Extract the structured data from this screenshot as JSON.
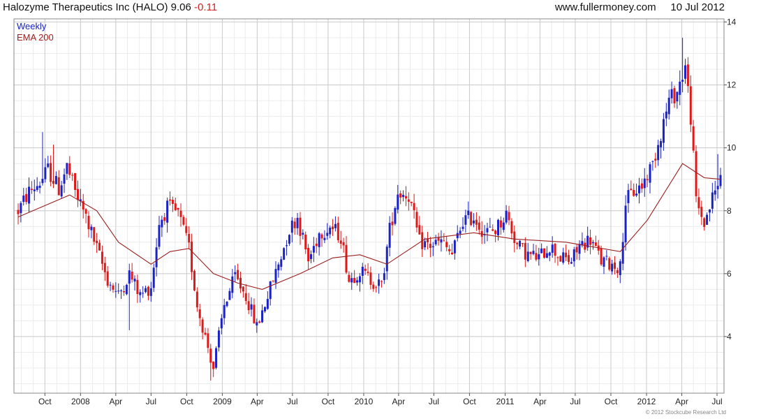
{
  "header": {
    "title": "Halozyme Therapeutics Inc (HALO)",
    "last": "9.06",
    "change": "-0.11",
    "source": "www.fullermoney.com",
    "date": "10 Jul 2012"
  },
  "legend": {
    "period": "Weekly",
    "ema": "EMA 200"
  },
  "copyright": "© 2012 Stockcube Research Ltd",
  "colors": {
    "up": "#1a22c8",
    "down": "#e01818",
    "ema": "#9a2020",
    "grid": "#cccccc",
    "header_change": "#d42020"
  },
  "chart_data": {
    "type": "candlestick",
    "period": "weekly",
    "ylim": [
      2.2,
      14.1
    ],
    "y_ticks": [
      4,
      6,
      8,
      10,
      12,
      14
    ],
    "y_axis_side": "right",
    "grid": true,
    "x_range": [
      "2007-07-24",
      "2012-07-10"
    ],
    "x_ticks": [
      {
        "date": "2007-10-01",
        "label": "Oct"
      },
      {
        "date": "2008-01-01",
        "label": "2008"
      },
      {
        "date": "2008-04-01",
        "label": "Apr"
      },
      {
        "date": "2008-07-01",
        "label": "Jul"
      },
      {
        "date": "2008-10-01",
        "label": "Oct"
      },
      {
        "date": "2009-01-01",
        "label": "2009"
      },
      {
        "date": "2009-04-01",
        "label": "Apr"
      },
      {
        "date": "2009-07-01",
        "label": "Jul"
      },
      {
        "date": "2009-10-01",
        "label": "Oct"
      },
      {
        "date": "2010-01-01",
        "label": "2010"
      },
      {
        "date": "2010-04-01",
        "label": "Apr"
      },
      {
        "date": "2010-07-01",
        "label": "Jul"
      },
      {
        "date": "2010-10-01",
        "label": "Oct"
      },
      {
        "date": "2011-01-01",
        "label": "2011"
      },
      {
        "date": "2011-04-01",
        "label": "Apr"
      },
      {
        "date": "2011-07-01",
        "label": "Jul"
      },
      {
        "date": "2011-10-01",
        "label": "Oct"
      },
      {
        "date": "2012-01-01",
        "label": "2012"
      },
      {
        "date": "2012-04-01",
        "label": "Apr"
      },
      {
        "date": "2012-07-01",
        "label": "Jul"
      }
    ],
    "price_path": [
      [
        "2007-07-24",
        8.0
      ],
      [
        "2007-08-21",
        8.6
      ],
      [
        "2007-09-18",
        8.9
      ],
      [
        "2007-10-09",
        9.3
      ],
      [
        "2007-11-06",
        8.7
      ],
      [
        "2007-11-27",
        9.4
      ],
      [
        "2007-12-18",
        8.6
      ],
      [
        "2008-01-15",
        7.8
      ],
      [
        "2008-02-12",
        6.8
      ],
      [
        "2008-03-11",
        5.8
      ],
      [
        "2008-04-08",
        5.3
      ],
      [
        "2008-05-06",
        6.0
      ],
      [
        "2008-06-03",
        5.3
      ],
      [
        "2008-07-01",
        5.6
      ],
      [
        "2008-07-22",
        7.6
      ],
      [
        "2008-08-12",
        8.1
      ],
      [
        "2008-09-09",
        7.9
      ],
      [
        "2008-10-07",
        6.8
      ],
      [
        "2008-10-28",
        5.0
      ],
      [
        "2008-11-18",
        4.0
      ],
      [
        "2008-12-09",
        3.0
      ],
      [
        "2009-01-06",
        5.0
      ],
      [
        "2009-02-03",
        5.9
      ],
      [
        "2009-03-03",
        5.3
      ],
      [
        "2009-03-31",
        4.3
      ],
      [
        "2009-04-28",
        5.3
      ],
      [
        "2009-05-26",
        6.3
      ],
      [
        "2009-06-23",
        7.4
      ],
      [
        "2009-07-14",
        7.8
      ],
      [
        "2009-08-11",
        6.4
      ],
      [
        "2009-09-08",
        7.3
      ],
      [
        "2009-10-06",
        7.5
      ],
      [
        "2009-11-03",
        7.2
      ],
      [
        "2009-11-24",
        5.8
      ],
      [
        "2009-12-22",
        6.1
      ],
      [
        "2010-01-19",
        5.8
      ],
      [
        "2010-02-16",
        5.6
      ],
      [
        "2010-03-09",
        7.4
      ],
      [
        "2010-03-30",
        8.6
      ],
      [
        "2010-04-27",
        8.5
      ],
      [
        "2010-05-25",
        7.0
      ],
      [
        "2010-06-22",
        6.9
      ],
      [
        "2010-07-20",
        7.0
      ],
      [
        "2010-08-17",
        6.6
      ],
      [
        "2010-09-14",
        7.7
      ],
      [
        "2010-10-12",
        7.8
      ],
      [
        "2010-11-09",
        7.3
      ],
      [
        "2010-12-07",
        7.4
      ],
      [
        "2011-01-04",
        7.9
      ],
      [
        "2011-02-01",
        6.9
      ],
      [
        "2011-03-01",
        6.6
      ],
      [
        "2011-03-29",
        6.5
      ],
      [
        "2011-04-26",
        6.9
      ],
      [
        "2011-05-24",
        6.5
      ],
      [
        "2011-06-21",
        6.4
      ],
      [
        "2011-07-12",
        6.9
      ],
      [
        "2011-08-09",
        7.1
      ],
      [
        "2011-09-06",
        6.4
      ],
      [
        "2011-10-04",
        6.3
      ],
      [
        "2011-10-25",
        6.2
      ],
      [
        "2011-11-08",
        8.3
      ],
      [
        "2011-11-29",
        8.6
      ],
      [
        "2011-12-20",
        8.8
      ],
      [
        "2012-01-17",
        9.5
      ],
      [
        "2012-02-07",
        10.5
      ],
      [
        "2012-02-28",
        11.5
      ],
      [
        "2012-03-20",
        11.8
      ],
      [
        "2012-04-10",
        12.6
      ],
      [
        "2012-04-24",
        11.0
      ],
      [
        "2012-05-08",
        8.3
      ],
      [
        "2012-05-29",
        7.6
      ],
      [
        "2012-06-19",
        8.4
      ],
      [
        "2012-07-10",
        9.06
      ]
    ],
    "ema_path": [
      [
        "2007-07-24",
        7.8
      ],
      [
        "2007-12-04",
        8.5
      ],
      [
        "2008-02-12",
        8.0
      ],
      [
        "2008-04-08",
        7.0
      ],
      [
        "2008-07-01",
        6.3
      ],
      [
        "2008-08-19",
        6.7
      ],
      [
        "2008-10-07",
        6.8
      ],
      [
        "2008-12-09",
        6.0
      ],
      [
        "2009-02-10",
        5.7
      ],
      [
        "2009-04-14",
        5.5
      ],
      [
        "2009-07-21",
        6.0
      ],
      [
        "2009-10-13",
        6.5
      ],
      [
        "2009-12-22",
        6.6
      ],
      [
        "2010-03-02",
        6.3
      ],
      [
        "2010-06-08",
        7.1
      ],
      [
        "2010-10-12",
        7.3
      ],
      [
        "2011-01-25",
        7.1
      ],
      [
        "2011-06-07",
        7.0
      ],
      [
        "2011-10-25",
        6.7
      ],
      [
        "2012-01-03",
        7.7
      ],
      [
        "2012-04-03",
        9.5
      ],
      [
        "2012-05-29",
        9.05
      ],
      [
        "2012-07-10",
        9.0
      ]
    ],
    "spikes": [
      {
        "date": "2007-09-25",
        "high": 10.5
      },
      {
        "date": "2007-10-23",
        "high": 10.1
      },
      {
        "date": "2008-05-06",
        "low": 4.2
      },
      {
        "date": "2008-12-02",
        "low": 2.6
      },
      {
        "date": "2012-04-03",
        "high": 13.5
      },
      {
        "date": "2012-04-24",
        "low": 10.5
      },
      {
        "date": "2012-07-03",
        "high": 9.8
      }
    ]
  }
}
